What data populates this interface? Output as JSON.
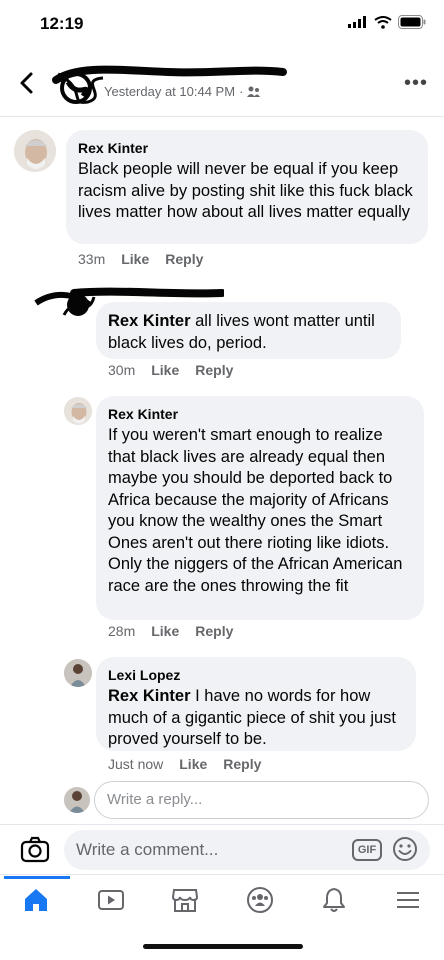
{
  "status_bar": {
    "time": "12:19"
  },
  "header": {
    "timestamp": "Yesterday at 10:44 PM",
    "separator": "·"
  },
  "comments": [
    {
      "author": "Rex Kinter",
      "text": "Black people will never be equal if you keep racism alive by posting shit like this fuck black lives matter how about all lives matter equally",
      "time": "33m",
      "like": "Like",
      "reply": "Reply"
    },
    {
      "author": "",
      "mention": "Rex Kinter",
      "text": " all lives wont matter until black lives do, period.",
      "time": "30m",
      "like": "Like",
      "reply": "Reply"
    },
    {
      "author": "Rex Kinter",
      "text": "If you weren't smart enough to realize that black lives are already equal then maybe you should be deported back to Africa because the majority of Africans you know the wealthy ones the Smart Ones aren't out there rioting like idiots. Only the niggers of the African American race are the ones throwing the fit",
      "time": "28m",
      "like": "Like",
      "reply": "Reply"
    },
    {
      "author": "Lexi Lopez",
      "mention": "Rex Kinter",
      "text": " I have no words for how much of a gigantic piece of shit you just proved yourself to be.",
      "time": "Just now",
      "like": "Like",
      "reply": "Reply"
    }
  ],
  "reply_box": {
    "placeholder": "Write a reply..."
  },
  "composer": {
    "placeholder": "Write a comment...",
    "gif_label": "GIF"
  },
  "icons": {
    "back": "chevron-left-icon",
    "more": "more-icon",
    "camera": "camera-icon",
    "gif": "gif-icon",
    "emoji": "emoji-icon",
    "home": "home-icon",
    "watch": "video-icon",
    "marketplace": "marketplace-icon",
    "groups": "groups-icon",
    "notifications": "bell-icon",
    "menu": "menu-icon"
  },
  "colors": {
    "accent": "#1877f2",
    "bubble": "#f0f2f5",
    "meta": "#65676b"
  }
}
